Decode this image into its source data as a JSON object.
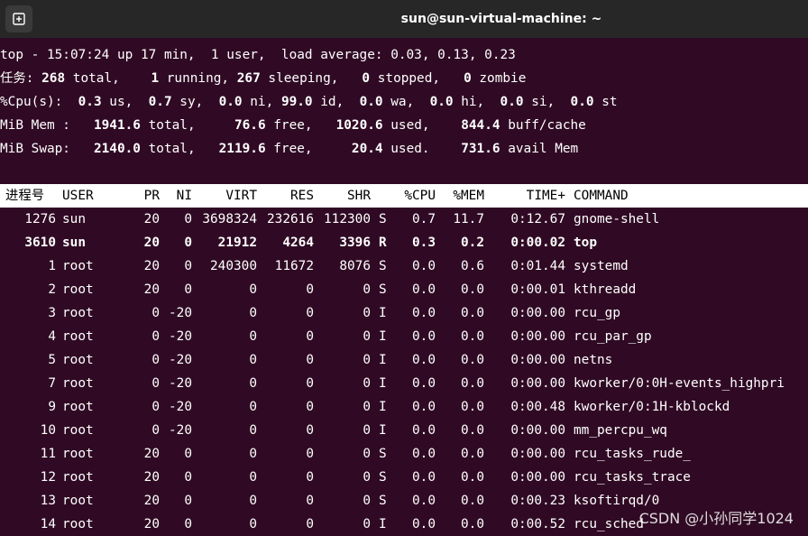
{
  "window": {
    "title": "sun@sun-virtual-machine: ~",
    "new_tab_icon": "new-tab-icon"
  },
  "summary": {
    "line1": "top - 15:07:24 up 17 min,  1 user,  load average: 0.03, 0.13, 0.23",
    "tasks": {
      "label": "任务:",
      "total": "268",
      "total_label": " total,",
      "running": "1",
      "running_label": " running,",
      "sleeping": "267",
      "sleeping_label": " sleeping,",
      "stopped": "0",
      "stopped_label": " stopped,",
      "zombie": "0",
      "zombie_label": " zombie"
    },
    "cpu": {
      "label": "%Cpu(s):",
      "us": "0.3",
      "sy": "0.7",
      "ni": "0.0",
      "id": "99.0",
      "wa": "0.0",
      "hi": "0.0",
      "si": "0.0",
      "st": "0.0"
    },
    "mem": {
      "label": "MiB Mem :",
      "total": "1941.6",
      "free": "76.6",
      "used": "1020.6",
      "buff": "844.4",
      "total_label": " total,",
      "free_label": " free,",
      "used_label": " used,",
      "buff_label": " buff/cache"
    },
    "swap": {
      "label": "MiB Swap:",
      "total": "2140.0",
      "free": "2119.6",
      "used": "20.4",
      "avail": "731.6",
      "total_label": " total,",
      "free_label": " free,",
      "used_label": " used.",
      "avail_label": " avail Mem"
    }
  },
  "table": {
    "headers": [
      "进程号",
      "USER",
      "PR",
      "NI",
      "VIRT",
      "RES",
      "SHR",
      "",
      "%CPU",
      "%MEM",
      "TIME+",
      "COMMAND"
    ],
    "rows": [
      [
        "1276",
        "sun",
        "20",
        "0",
        "3698324",
        "232616",
        "112300",
        "S",
        "0.7",
        "11.7",
        "0:12.67",
        "gnome-shell"
      ],
      [
        "3610",
        "sun",
        "20",
        "0",
        "21912",
        "4264",
        "3396",
        "R",
        "0.3",
        "0.2",
        "0:00.02",
        "top"
      ],
      [
        "1",
        "root",
        "20",
        "0",
        "240300",
        "11672",
        "8076",
        "S",
        "0.0",
        "0.6",
        "0:01.44",
        "systemd"
      ],
      [
        "2",
        "root",
        "20",
        "0",
        "0",
        "0",
        "0",
        "S",
        "0.0",
        "0.0",
        "0:00.01",
        "kthreadd"
      ],
      [
        "3",
        "root",
        "0",
        "-20",
        "0",
        "0",
        "0",
        "I",
        "0.0",
        "0.0",
        "0:00.00",
        "rcu_gp"
      ],
      [
        "4",
        "root",
        "0",
        "-20",
        "0",
        "0",
        "0",
        "I",
        "0.0",
        "0.0",
        "0:00.00",
        "rcu_par_gp"
      ],
      [
        "5",
        "root",
        "0",
        "-20",
        "0",
        "0",
        "0",
        "I",
        "0.0",
        "0.0",
        "0:00.00",
        "netns"
      ],
      [
        "7",
        "root",
        "0",
        "-20",
        "0",
        "0",
        "0",
        "I",
        "0.0",
        "0.0",
        "0:00.00",
        "kworker/0:0H-events_highpri"
      ],
      [
        "9",
        "root",
        "0",
        "-20",
        "0",
        "0",
        "0",
        "I",
        "0.0",
        "0.0",
        "0:00.48",
        "kworker/0:1H-kblockd"
      ],
      [
        "10",
        "root",
        "0",
        "-20",
        "0",
        "0",
        "0",
        "I",
        "0.0",
        "0.0",
        "0:00.00",
        "mm_percpu_wq"
      ],
      [
        "11",
        "root",
        "20",
        "0",
        "0",
        "0",
        "0",
        "S",
        "0.0",
        "0.0",
        "0:00.00",
        "rcu_tasks_rude_"
      ],
      [
        "12",
        "root",
        "20",
        "0",
        "0",
        "0",
        "0",
        "S",
        "0.0",
        "0.0",
        "0:00.00",
        "rcu_tasks_trace"
      ],
      [
        "13",
        "root",
        "20",
        "0",
        "0",
        "0",
        "0",
        "S",
        "0.0",
        "0.0",
        "0:00.23",
        "ksoftirqd/0"
      ],
      [
        "14",
        "root",
        "20",
        "0",
        "0",
        "0",
        "0",
        "I",
        "0.0",
        "0.0",
        "0:00.52",
        "rcu_sched"
      ]
    ],
    "bold_row": 1
  },
  "watermark": "CSDN @小孙同学1024",
  "colors": {
    "background": "#300a24",
    "titlebar": "#272727",
    "header_bg": "#ffffff"
  }
}
